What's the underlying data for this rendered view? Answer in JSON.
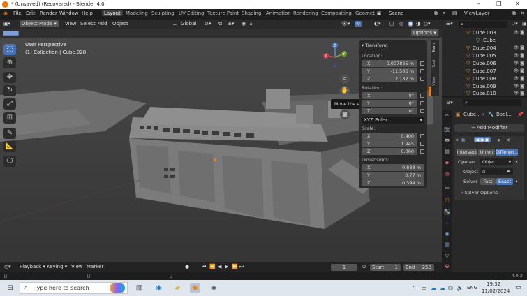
{
  "window": {
    "title": "* (Unsaved) (Recovered) - Blender 4.0",
    "controls": [
      "–",
      "❐",
      "✕"
    ]
  },
  "menu": {
    "items": [
      "File",
      "Edit",
      "Render",
      "Window",
      "Help"
    ]
  },
  "workspaces": {
    "tabs": [
      "Layout",
      "Modeling",
      "Sculpting",
      "UV Editing",
      "Texture Paint",
      "Shading",
      "Animation",
      "Rendering",
      "Compositing",
      "Geomet"
    ],
    "active": "Layout"
  },
  "scene": {
    "label": "Scene",
    "view_layer": "ViewLayer"
  },
  "viewport_header": {
    "mode": "Object Mode",
    "view": "View",
    "select": "Select",
    "add": "Add",
    "object": "Object",
    "orientation": "Global",
    "options": "Options"
  },
  "viewport": {
    "perspective": "User Perspective",
    "collection": "(1) Collection | Cube.028",
    "tooltip": "Move the view"
  },
  "npanel": {
    "tabs": [
      "Item",
      "Tool",
      "View"
    ],
    "transform_title": "Transform",
    "location_label": "Location:",
    "location": [
      {
        "axis": "X",
        "value": "-0.007825 m"
      },
      {
        "axis": "Y",
        "value": "-11.506 m"
      },
      {
        "axis": "Z",
        "value": "2.132 m"
      }
    ],
    "rotation_label": "Rotation:",
    "rotation": [
      {
        "axis": "X",
        "value": "0°"
      },
      {
        "axis": "Y",
        "value": "0°"
      },
      {
        "axis": "Z",
        "value": "0°"
      }
    ],
    "rotation_mode": "XYZ Euler",
    "scale_label": "Scale:",
    "scale": [
      {
        "axis": "X",
        "value": "0.400"
      },
      {
        "axis": "Y",
        "value": "1.945"
      },
      {
        "axis": "Z",
        "value": "0.060"
      }
    ],
    "dimensions_label": "Dimensions:",
    "dimensions": [
      {
        "axis": "X",
        "value": "0.888 m"
      },
      {
        "axis": "Y",
        "value": "3.77 m"
      },
      {
        "axis": "Z",
        "value": "0.394 m"
      }
    ]
  },
  "outliner": {
    "items": [
      {
        "name": "Cube.003",
        "kind": "object"
      },
      {
        "name": "Cube",
        "kind": "mesh"
      },
      {
        "name": "Cube.004",
        "kind": "object"
      },
      {
        "name": "Cube.005",
        "kind": "object"
      },
      {
        "name": "Cube.006",
        "kind": "object"
      },
      {
        "name": "Cube.007",
        "kind": "object"
      },
      {
        "name": "Cube.008",
        "kind": "object"
      },
      {
        "name": "Cube.009",
        "kind": "object"
      },
      {
        "name": "Cube.010",
        "kind": "object"
      }
    ]
  },
  "properties": {
    "breadcrumb_object": "Cube...",
    "breadcrumb_modifier": "Bool...",
    "add_modifier": "Add Modifier",
    "operations": [
      "Intersect",
      "Union",
      "Differen..."
    ],
    "active_operation": "Differen...",
    "operand_label": "Operan...",
    "operand_value": "Object",
    "object_label": "Object",
    "solver_label": "Solver",
    "solvers": [
      "Fast",
      "Exact"
    ],
    "active_solver": "Exact",
    "solver_options": "Solver Options"
  },
  "timeline": {
    "playback": "Playback",
    "keying": "Keying",
    "view": "View",
    "marker": "Marker",
    "current_frame": "1",
    "start_label": "Start",
    "start": "1",
    "end_label": "End",
    "end": "250"
  },
  "statusbar": {
    "version": "4.0.2"
  },
  "taskbar": {
    "search_placeholder": "Type here to search",
    "language": "ENG",
    "time": "19:32",
    "date": "11/02/2024"
  },
  "colors": {
    "accent": "#4772b3",
    "object_orange": "#e88f2a",
    "viewport_bg": "#3d3d3d",
    "header_bg": "#2a2a2a",
    "taskbar_bg": "#dfe6ee"
  }
}
